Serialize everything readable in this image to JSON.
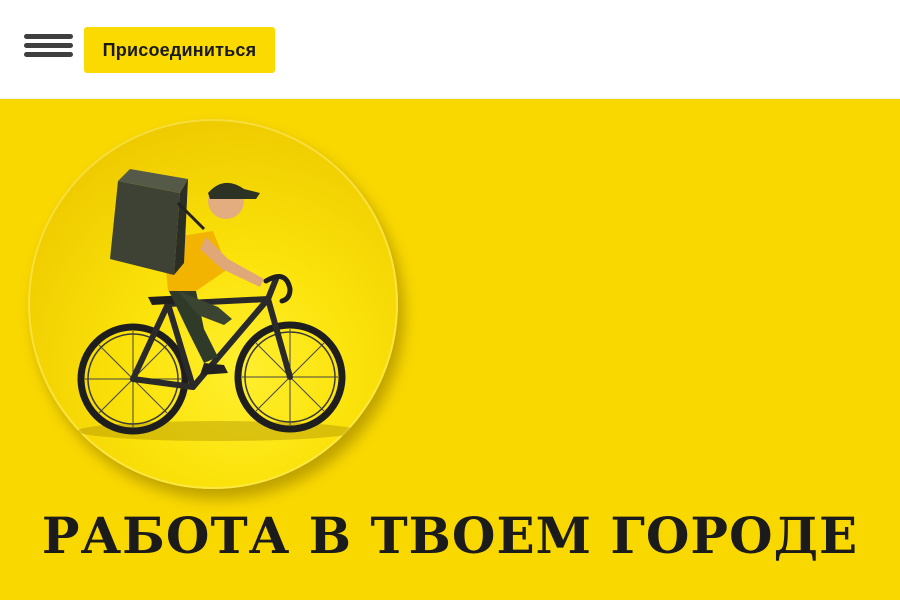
{
  "header": {
    "menu_icon": "hamburger-menu-icon",
    "join_label": "Присоединиться"
  },
  "hero": {
    "illustration": "delivery-cyclist-icon",
    "headline": "РАБОТА В ТВОЕМ ГОРОДЕ"
  },
  "colors": {
    "accent": "#fada00",
    "hero_background": "#f9d800",
    "text": "#1b1b1b"
  }
}
